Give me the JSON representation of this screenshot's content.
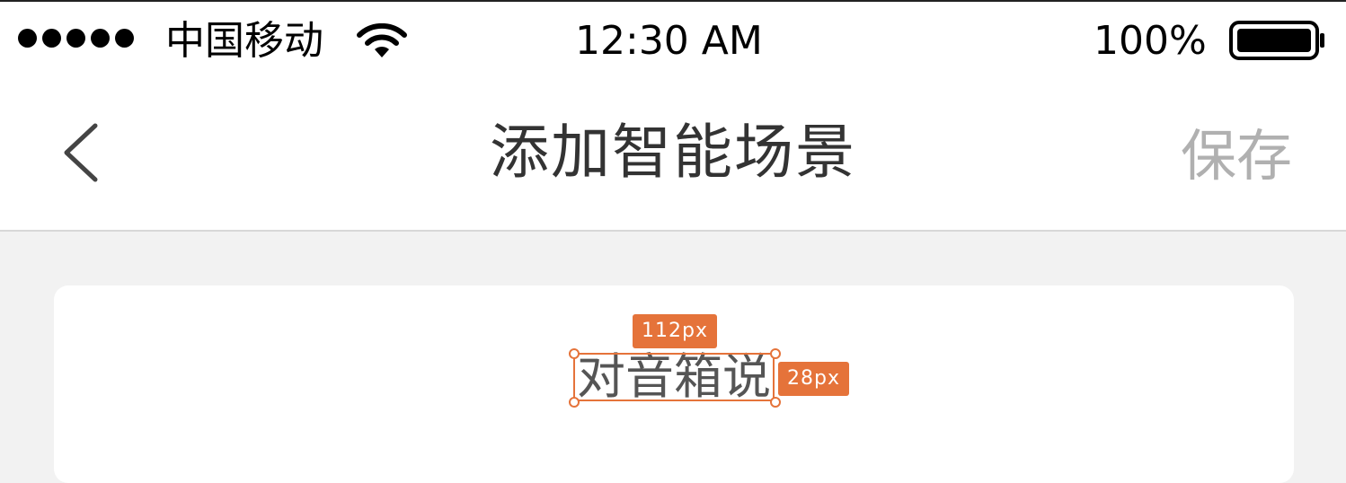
{
  "status_bar": {
    "carrier": "中国移动",
    "time": "12:30 AM",
    "battery_percent": "100%",
    "signal_bars": 5,
    "battery_level": 1.0
  },
  "nav": {
    "title": "添加智能场景",
    "save_label": "保存",
    "back_icon": "chevron-left-icon"
  },
  "card": {
    "text": "对音箱说"
  },
  "annotations": {
    "width_badge": "112px",
    "height_badge": "28px"
  },
  "colors": {
    "accent": "#e5733a",
    "title": "#333333",
    "save_disabled": "#b0b0b0",
    "background": "#f2f2f2"
  }
}
